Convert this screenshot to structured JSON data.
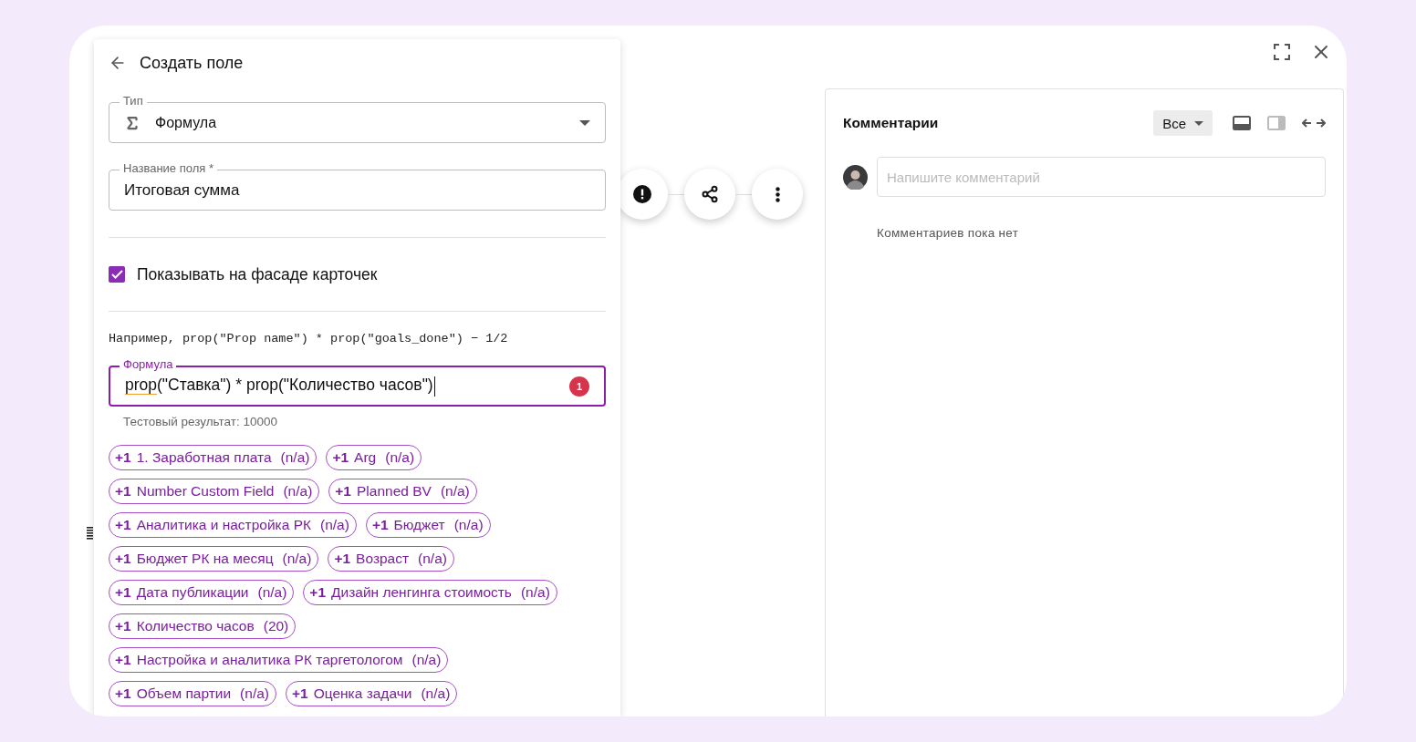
{
  "field_editor": {
    "title": "Создать поле",
    "type_field": {
      "label": "Тип",
      "value": "Формула"
    },
    "name_field": {
      "label": "Название поля *",
      "value": "Итоговая сумма"
    },
    "show_on_card": {
      "label": "Показывать на фасаде карточек",
      "checked": true
    },
    "example": "Например, prop(\"Prop name\") * prop(\"goals_done\") − 1/2",
    "formula_field": {
      "label": "Формула",
      "segments": [
        {
          "text": "prop",
          "flagged": true
        },
        {
          "text": "(\"Ставка\") * prop(\"Количество часов\")",
          "flagged": false
        }
      ],
      "error_count": "1"
    },
    "test_result": "Тестовый результат: 10000",
    "chips": [
      {
        "plus": "+1",
        "name": "1. Заработная плата",
        "value": "(n/a)"
      },
      {
        "plus": "+1",
        "name": "Arg",
        "value": "(n/a)"
      },
      {
        "plus": "+1",
        "name": "Number Custom Field",
        "value": "(n/a)"
      },
      {
        "plus": "+1",
        "name": "Planned BV",
        "value": "(n/a)"
      },
      {
        "plus": "+1",
        "name": "Аналитика и настройка РК",
        "value": "(n/a)"
      },
      {
        "plus": "+1",
        "name": "Бюджет",
        "value": "(n/a)"
      },
      {
        "plus": "+1",
        "name": "Бюджет РК на месяц",
        "value": "(n/a)"
      },
      {
        "plus": "+1",
        "name": "Возраст",
        "value": "(n/a)"
      },
      {
        "plus": "+1",
        "name": "Дата публикации",
        "value": "(n/a)"
      },
      {
        "plus": "+1",
        "name": "Дизайн ленгинга стоимость",
        "value": "(n/a)"
      },
      {
        "plus": "+1",
        "name": "Количество часов",
        "value": "(20)"
      },
      {
        "plus": "+1",
        "name": "Настройка и аналитика РК таргетологом",
        "value": "(n/a)"
      },
      {
        "plus": "+1",
        "name": "Объем партии",
        "value": "(n/a)"
      },
      {
        "plus": "+1",
        "name": "Оценка задачи",
        "value": "(n/a)"
      }
    ]
  },
  "comments": {
    "title": "Комментарии",
    "filter": "Все",
    "placeholder": "Напишите комментарий",
    "empty_text": "Комментариев пока нет"
  }
}
